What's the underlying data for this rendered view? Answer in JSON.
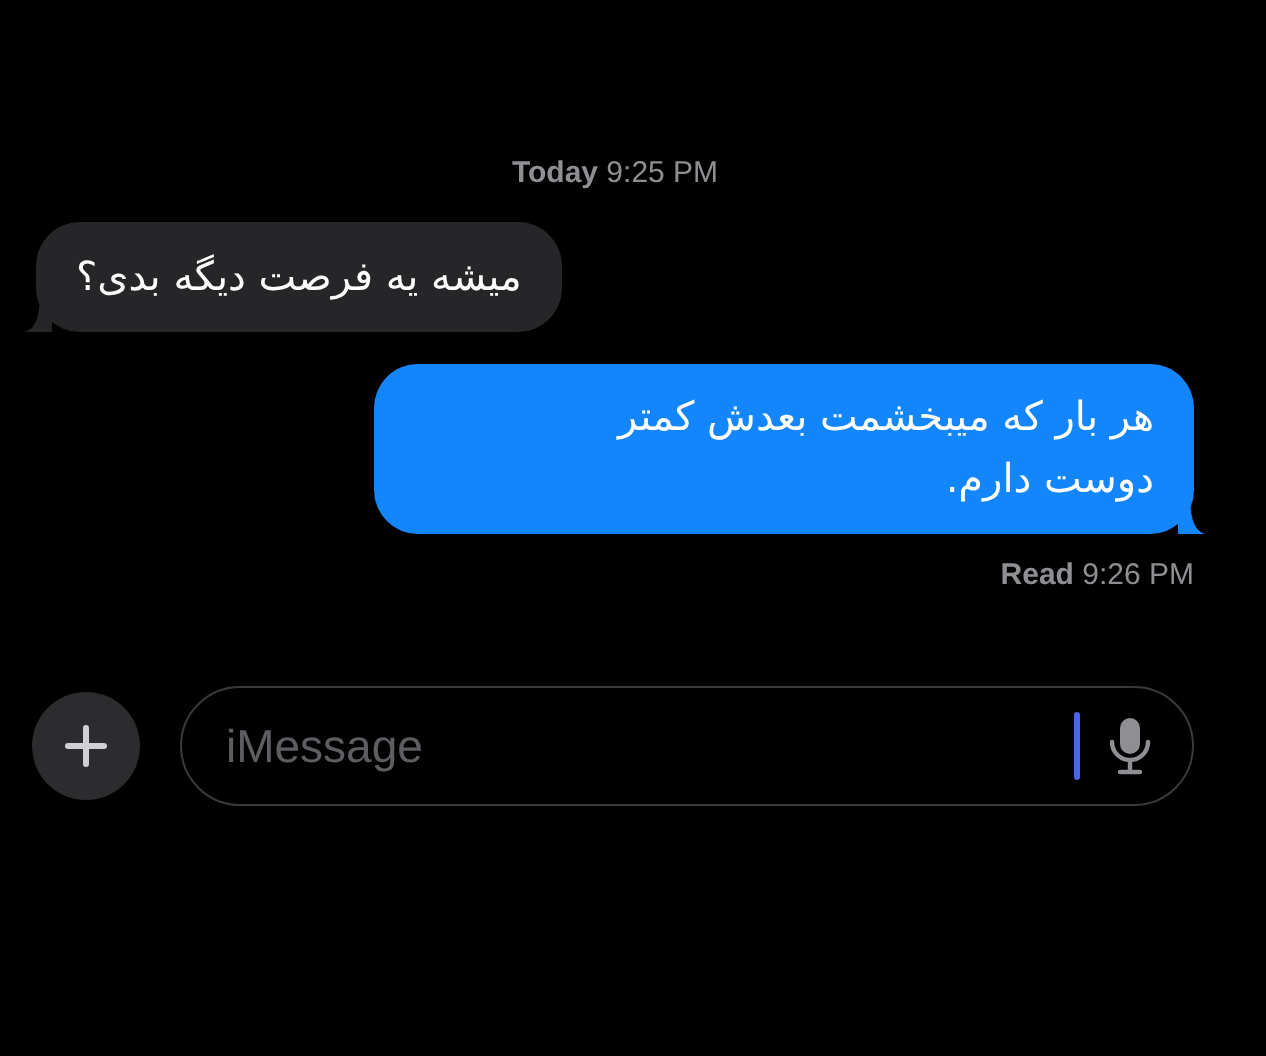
{
  "conversation": [
    {
      "kind": "timestamp",
      "text": "**Today** 9:25 PM"
    },
    {
      "kind": "incoming",
      "text": "میشه یه فرصت دیگه بدی؟"
    },
    {
      "kind": "outgoing",
      "text": "هر بار که میبخشمت بعدش کمتر دوست دارم."
    },
    {
      "kind": "receipt",
      "text": "**Read** 9:26 PM"
    }
  ],
  "composer": {
    "placeholder": "iMessage"
  }
}
